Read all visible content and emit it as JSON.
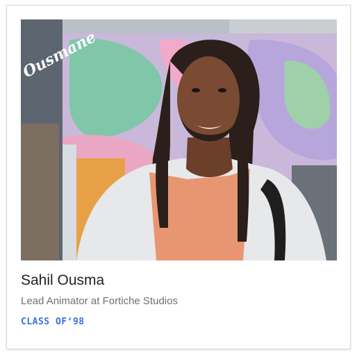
{
  "card": {
    "name": "Sahil Ousma",
    "title": "Lead Animator at Fortiche Studios",
    "class_label": "CLASS OF‘98",
    "signature_text": "Ousmane",
    "accent_color": "#3b6fe0"
  }
}
